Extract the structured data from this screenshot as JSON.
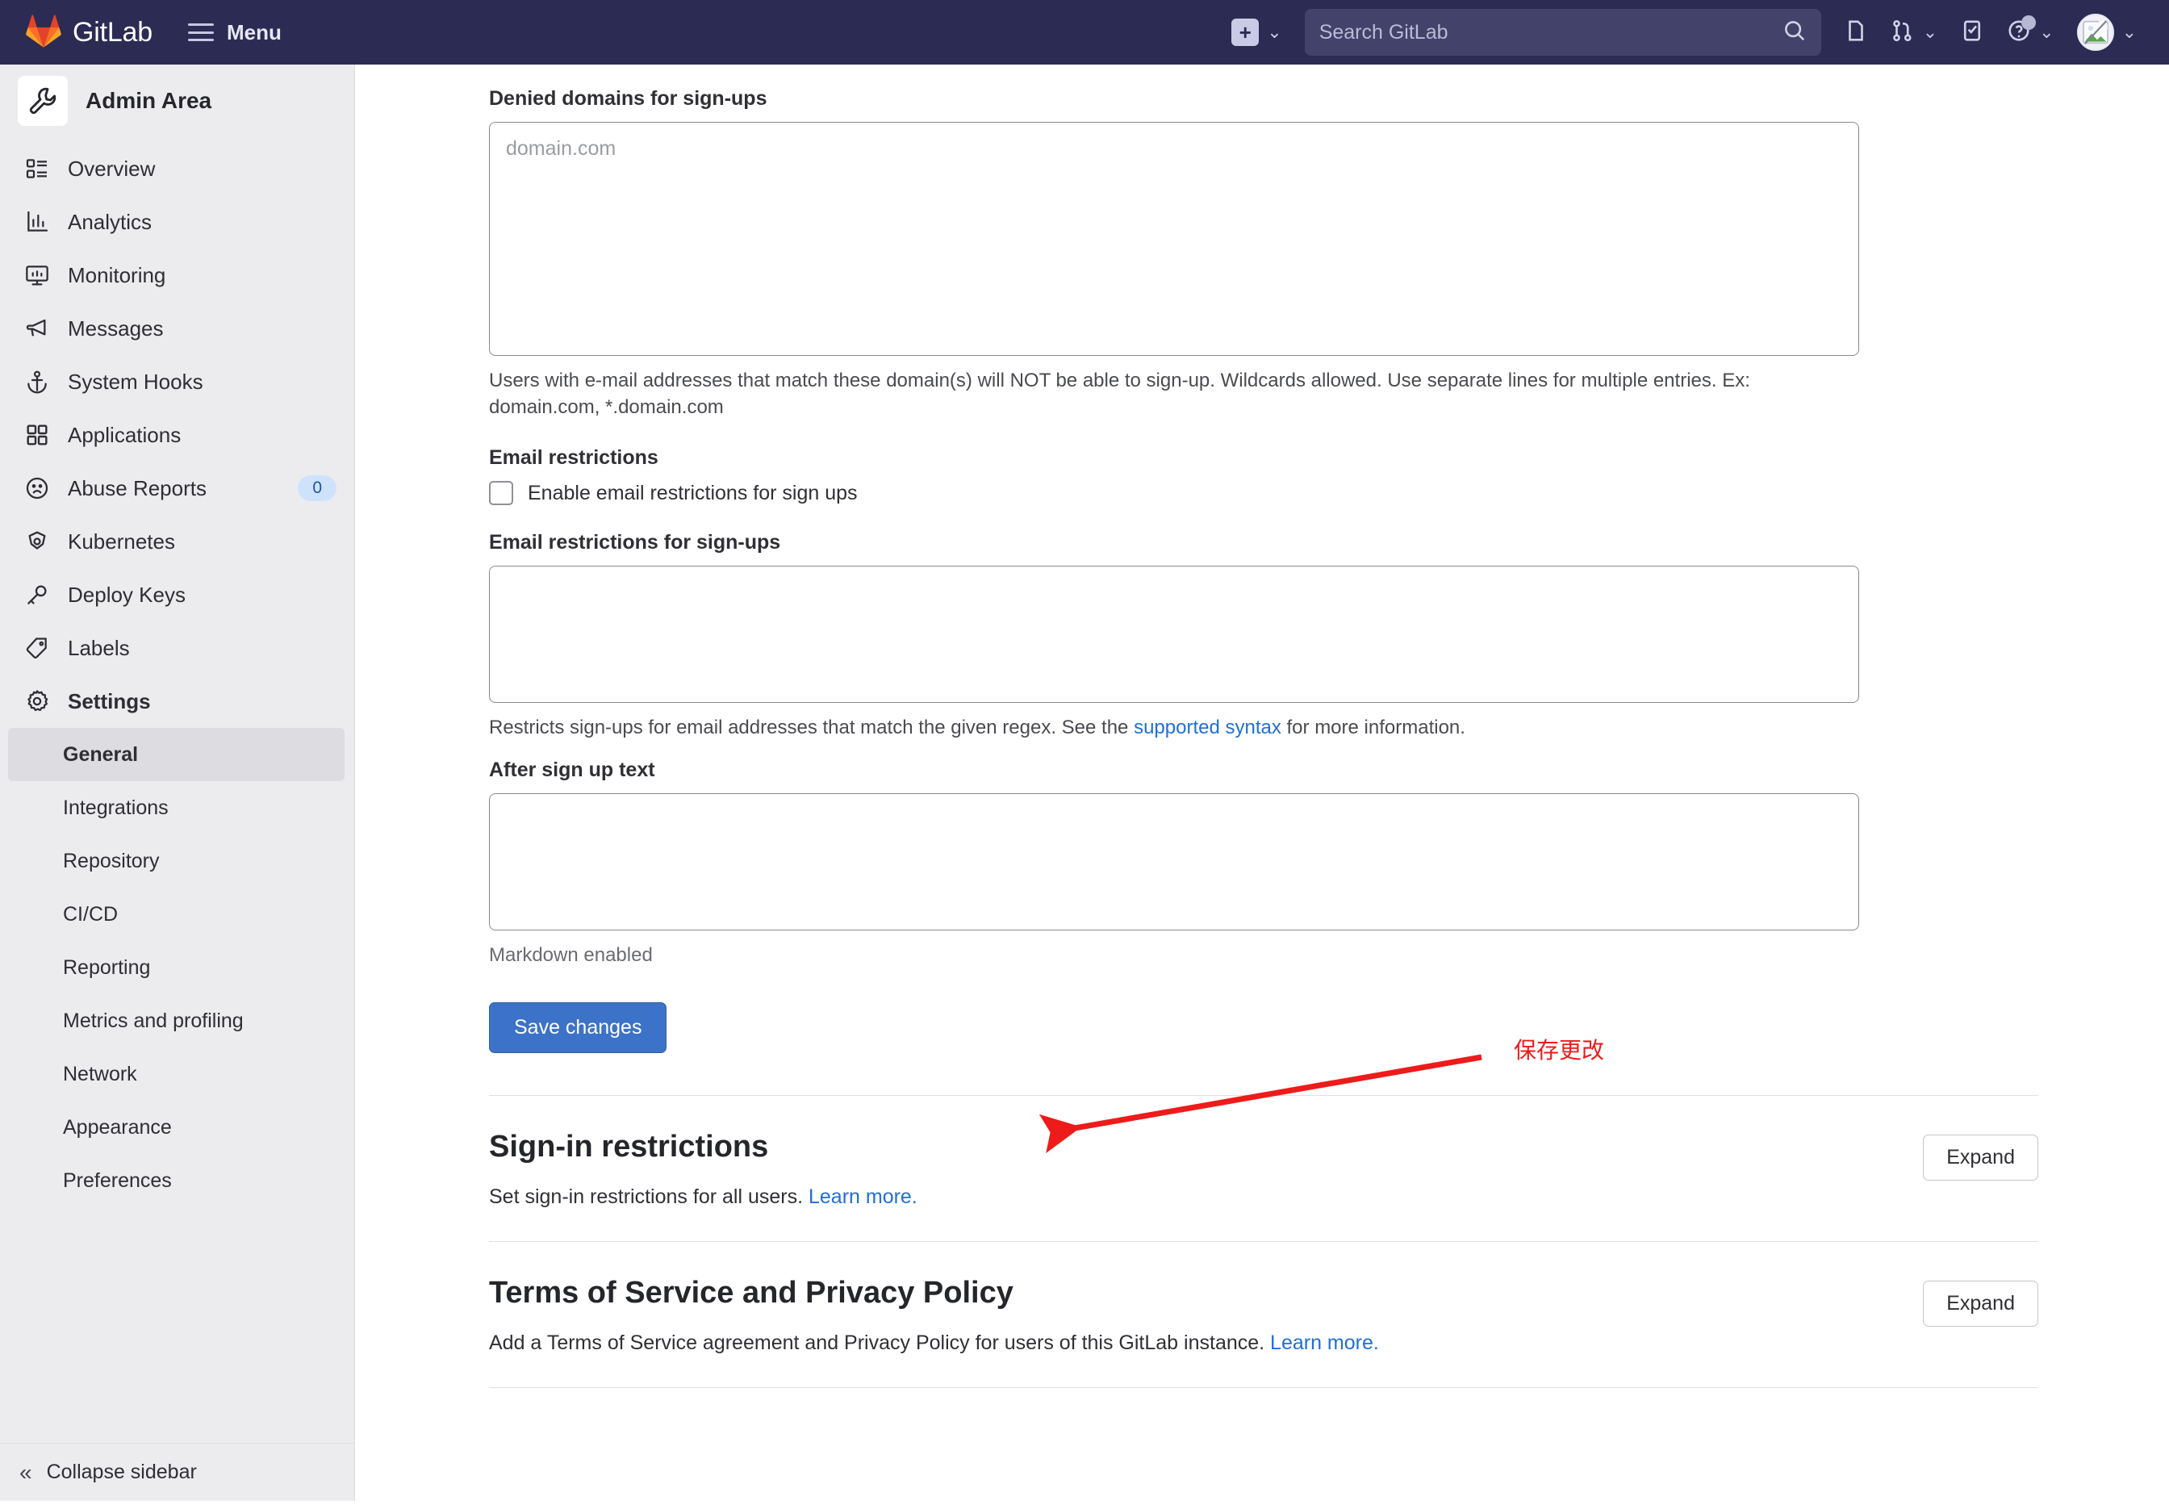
{
  "topnav": {
    "brand": "GitLab",
    "menu_label": "Menu",
    "create_icon": "plus-icon",
    "search_placeholder": "Search GitLab",
    "search_icon": "search-icon",
    "issues_icon": "issues-icon",
    "merge_requests_icon": "merge-request-icon",
    "todos_icon": "todo-checkbox-icon",
    "help_icon": "help-question-icon",
    "avatar_icon": "broken-image-avatar-icon",
    "chevron_icon": "chevron-down-icon"
  },
  "sidebar": {
    "title": "Admin Area",
    "title_icon": "wrench-icon",
    "items": [
      {
        "label": "Overview",
        "icon": "overview-list-icon",
        "bold": false,
        "badge": null
      },
      {
        "label": "Analytics",
        "icon": "analytics-chart-icon",
        "bold": false,
        "badge": null
      },
      {
        "label": "Monitoring",
        "icon": "monitor-icon",
        "bold": false,
        "badge": null
      },
      {
        "label": "Messages",
        "icon": "megaphone-icon",
        "bold": false,
        "badge": null
      },
      {
        "label": "System Hooks",
        "icon": "anchor-icon",
        "bold": false,
        "badge": null
      },
      {
        "label": "Applications",
        "icon": "grid-squares-icon",
        "bold": false,
        "badge": null
      },
      {
        "label": "Abuse Reports",
        "icon": "sad-face-icon",
        "bold": false,
        "badge": "0"
      },
      {
        "label": "Kubernetes",
        "icon": "kubernetes-icon",
        "bold": false,
        "badge": null
      },
      {
        "label": "Deploy Keys",
        "icon": "key-icon",
        "bold": false,
        "badge": null
      },
      {
        "label": "Labels",
        "icon": "label-tag-icon",
        "bold": false,
        "badge": null
      },
      {
        "label": "Settings",
        "icon": "gear-icon",
        "bold": true,
        "badge": null
      }
    ],
    "subitems": [
      {
        "label": "General",
        "active": true
      },
      {
        "label": "Integrations",
        "active": false
      },
      {
        "label": "Repository",
        "active": false
      },
      {
        "label": "CI/CD",
        "active": false
      },
      {
        "label": "Reporting",
        "active": false
      },
      {
        "label": "Metrics and profiling",
        "active": false
      },
      {
        "label": "Network",
        "active": false
      },
      {
        "label": "Appearance",
        "active": false
      },
      {
        "label": "Preferences",
        "active": false
      }
    ],
    "collapse_label": "Collapse sidebar",
    "collapse_icon": "chevron-double-left-icon"
  },
  "main": {
    "denied_domains": {
      "label": "Denied domains for sign-ups",
      "placeholder": "domain.com",
      "value": "",
      "helper_1": "Users with e-mail addresses that match these domain(s) will NOT be able to sign-up. Wildcards allowed. Use separate lines for",
      "helper_2": "multiple entries. Ex: domain.com, *.domain.com"
    },
    "email_restrictions": {
      "label": "Email restrictions",
      "checkbox_label": "Enable email restrictions for sign ups",
      "checked": false
    },
    "email_restrictions_signups": {
      "label": "Email restrictions for sign-ups",
      "value": "",
      "helper_prefix": "Restricts sign-ups for email addresses that match the given regex. See the ",
      "helper_link": "supported syntax",
      "helper_suffix": " for more information."
    },
    "after_sign_up_text": {
      "label": "After sign up text",
      "value": "",
      "helper": "Markdown enabled"
    },
    "save_label": "Save changes",
    "sections": [
      {
        "title": "Sign-in restrictions",
        "description_prefix": "Set sign-in restrictions for all users. ",
        "description_link": "Learn more.",
        "expand_label": "Expand"
      },
      {
        "title": "Terms of Service and Privacy Policy",
        "description_prefix": "Add a Terms of Service agreement and Privacy Policy for users of this GitLab instance. ",
        "description_link": "Learn more.",
        "expand_label": "Expand"
      }
    ]
  },
  "annotation": {
    "text": "保存更改",
    "color": "#ee1b1b",
    "arrow": "red-arrow-pointing-to-save-changes-button"
  },
  "colors": {
    "topnav_bg": "#2b2b53",
    "sidebar_bg": "#ececef",
    "active_item_bg": "#dcdce1",
    "primary_button": "#3c72c8",
    "link": "#1f6fd6",
    "annotation_red": "#ee1b1b"
  }
}
